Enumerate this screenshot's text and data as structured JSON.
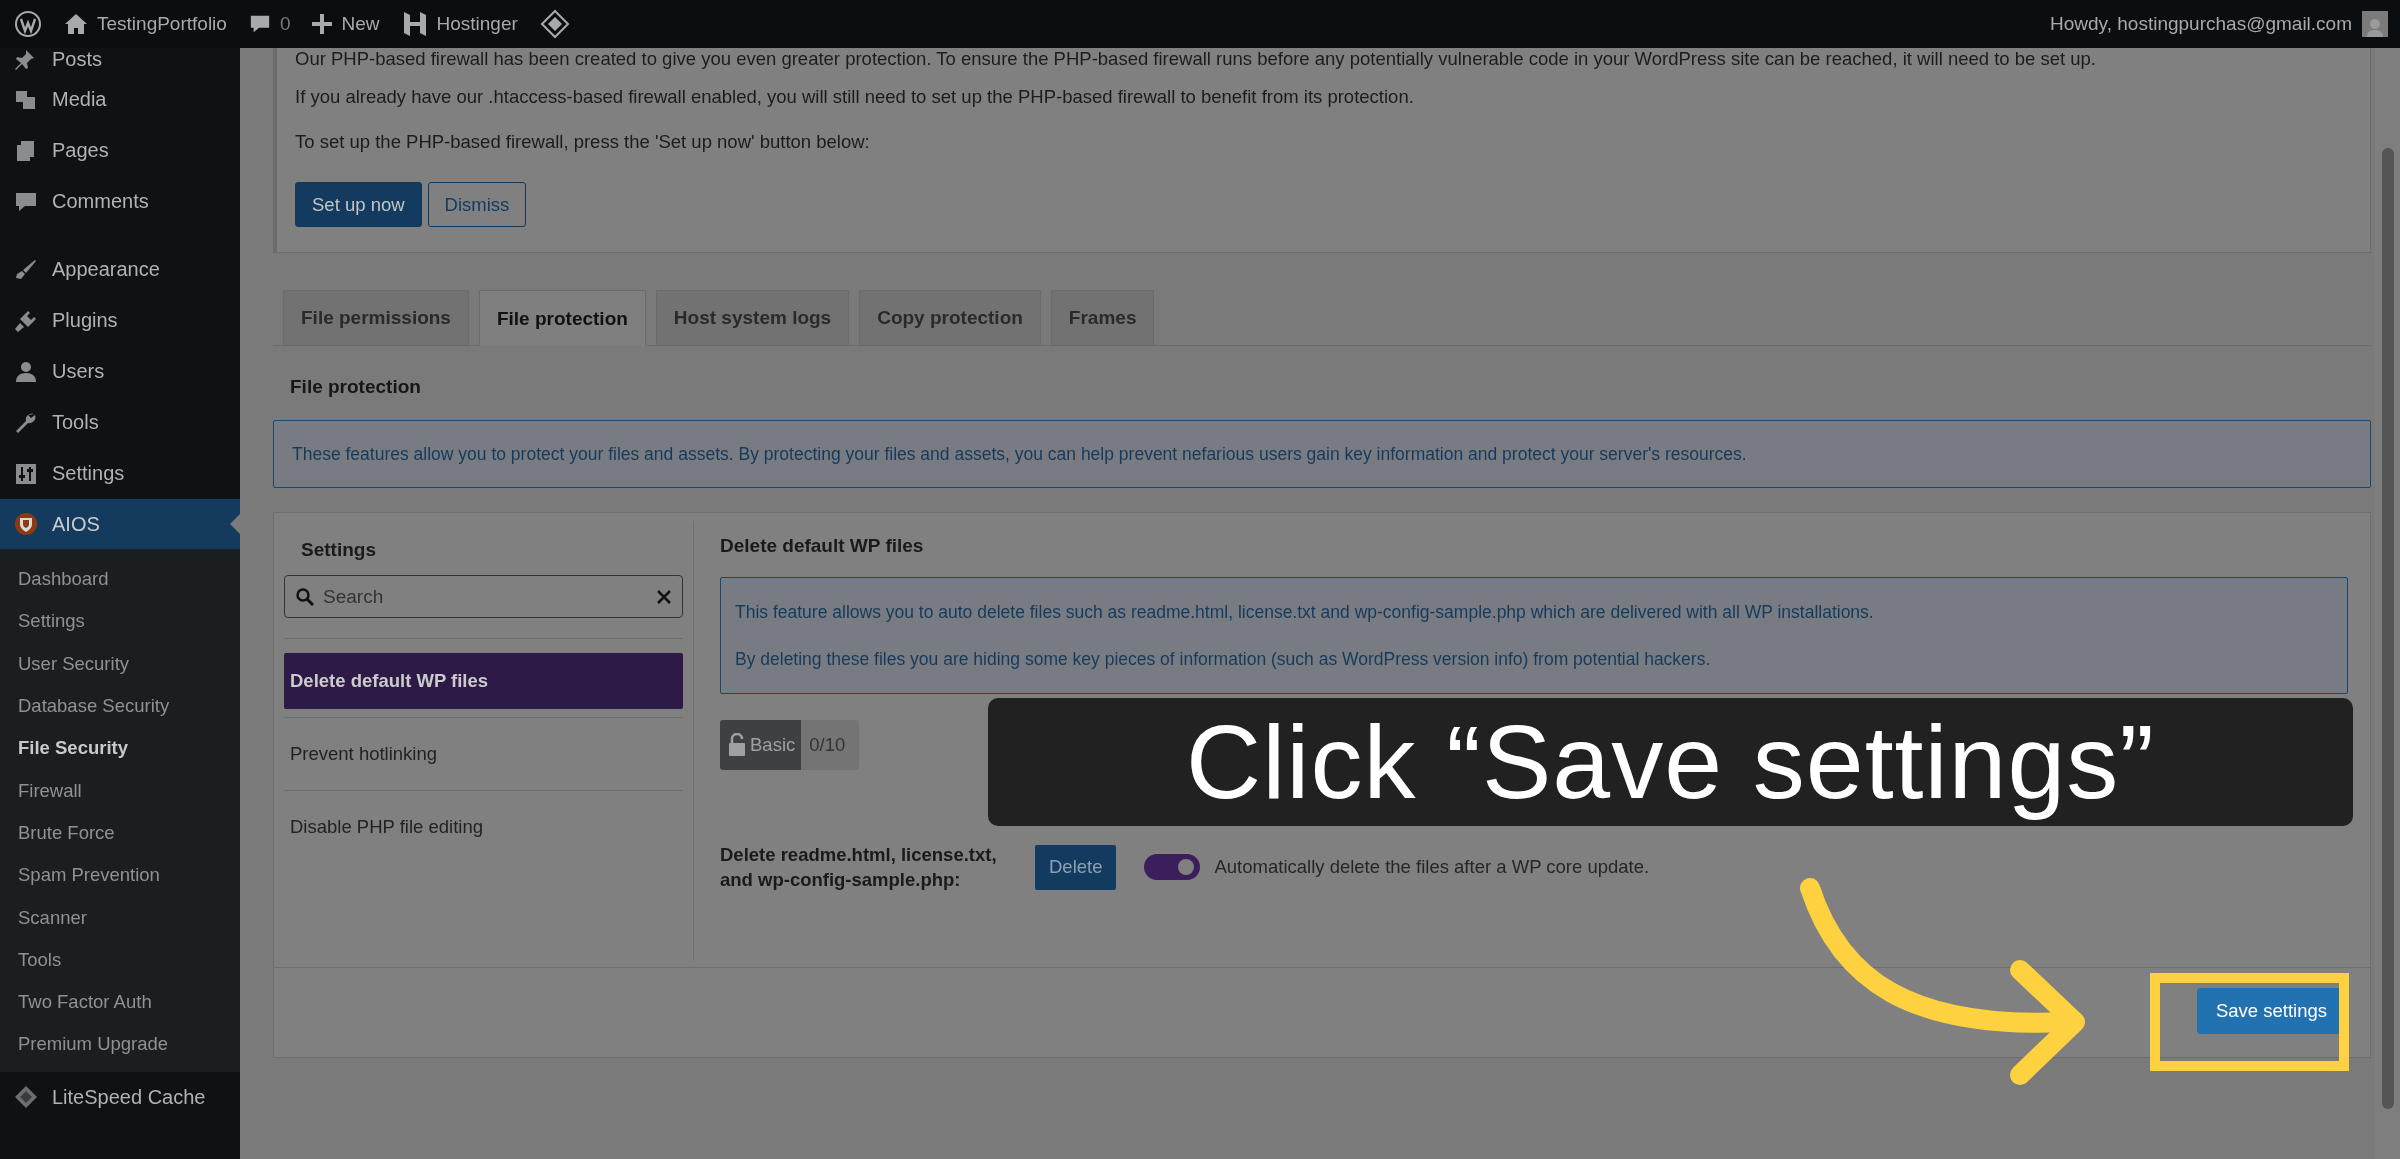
{
  "admin_bar": {
    "site": "TestingPortfolio",
    "comments": "0",
    "new": "New",
    "hosting": "Hostinger",
    "greeting": "Howdy, hostingpurchas@gmail.com"
  },
  "sidebar": {
    "items": [
      {
        "label": "Posts",
        "selected": false
      },
      {
        "label": "Media",
        "selected": false
      },
      {
        "label": "Pages",
        "selected": false
      },
      {
        "label": "Comments",
        "selected": false
      },
      {
        "label": "Appearance",
        "selected": false
      },
      {
        "label": "Plugins",
        "selected": false
      },
      {
        "label": "Users",
        "selected": false
      },
      {
        "label": "Tools",
        "selected": false
      },
      {
        "label": "Settings",
        "selected": false
      },
      {
        "label": "AIOS",
        "selected": true,
        "children": [
          {
            "label": "Dashboard",
            "selected": false
          },
          {
            "label": "Settings",
            "selected": false
          },
          {
            "label": "User Security",
            "selected": false
          },
          {
            "label": "Database Security",
            "selected": false
          },
          {
            "label": "File Security",
            "selected": true
          },
          {
            "label": "Firewall",
            "selected": false
          },
          {
            "label": "Brute Force",
            "selected": false
          },
          {
            "label": "Spam Prevention",
            "selected": false
          },
          {
            "label": "Scanner",
            "selected": false
          },
          {
            "label": "Tools",
            "selected": false
          },
          {
            "label": "Two Factor Auth",
            "selected": false
          },
          {
            "label": "Premium Upgrade",
            "selected": false
          }
        ]
      },
      {
        "label": "LiteSpeed Cache",
        "selected": false
      }
    ]
  },
  "notice": {
    "paragraphs": [
      "Our PHP-based firewall has been created to give you even greater protection. To ensure the PHP-based firewall runs before any potentially vulnerable code in your WordPress site can be reached, it will need to be set up.",
      "If you already have our .htaccess-based firewall enabled, you will still need to set up the PHP-based firewall to benefit from its protection.",
      "To set up the PHP-based firewall, press the 'Set up now' button below:"
    ],
    "buttons": [
      {
        "label": "Set up now",
        "kind": "primary"
      },
      {
        "label": "Dismiss",
        "kind": "secondary"
      }
    ]
  },
  "tabs": [
    {
      "label": "File permissions",
      "selected": false
    },
    {
      "label": "File protection",
      "selected": true
    },
    {
      "label": "Host system logs",
      "selected": false
    },
    {
      "label": "Copy protection",
      "selected": false
    },
    {
      "label": "Frames",
      "selected": false
    }
  ],
  "section_title": "File protection",
  "section_info": "These features allow you to protect your files and assets. By protecting your files and assets, you can help prevent nefarious users gain key information and protect your server's resources.",
  "settings_panel": {
    "title": "Settings",
    "search": {
      "placeholder": "Search"
    },
    "items": [
      {
        "label": "Delete default WP files",
        "selected": true
      },
      {
        "label": "Prevent hotlinking",
        "selected": false
      },
      {
        "label": "Disable PHP file editing",
        "selected": false
      }
    ]
  },
  "feature": {
    "title": "Delete default WP files",
    "info": [
      "This feature allows you to auto delete files such as readme.html, license.txt and wp-config-sample.php which are delivered with all WP installations.",
      "By deleting these files you are hiding some key pieces of information (such as WordPress version info) from potential hackers."
    ],
    "badge": {
      "label": "Basic",
      "score": "0/10"
    },
    "option": {
      "label": "Delete readme.html, license.txt, and wp-config-sample.php:",
      "button": "Delete",
      "toggle_on": true,
      "toggle_label": "Automatically delete the files after a WP core update."
    }
  },
  "save_button": "Save settings",
  "callout": {
    "text": "Click “Save settings”"
  }
}
